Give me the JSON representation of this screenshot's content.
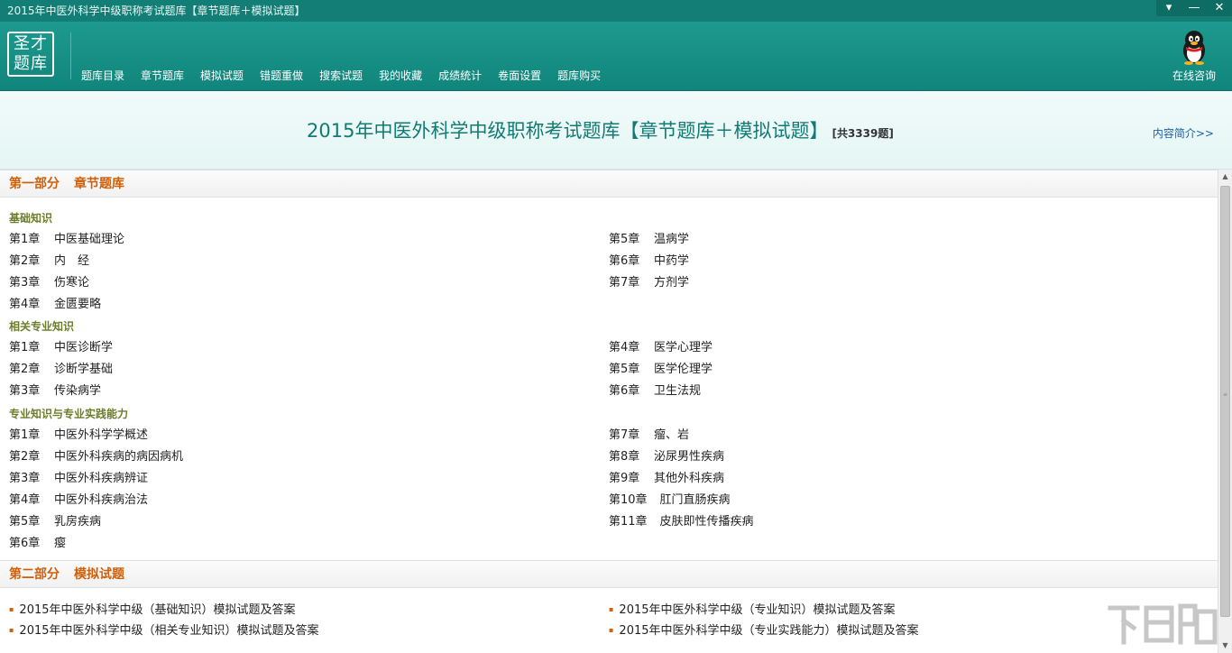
{
  "window": {
    "title": "2015年中医外科学中级职称考试题库【章节题库＋模拟试题】",
    "controls": [
      "▾",
      "—",
      "✕"
    ]
  },
  "logo": {
    "line1": "圣才",
    "line2": "题库"
  },
  "nav": [
    "题库目录",
    "章节题库",
    "模拟试题",
    "错题重做",
    "搜索试题",
    "我的收藏",
    "成绩统计",
    "卷面设置",
    "题库购买"
  ],
  "consult": {
    "label": "在线咨询",
    "icon": "qq-penguin-icon"
  },
  "header": {
    "title": "2015年中医外科学中级职称考试题库【章节题库＋模拟试题】",
    "count": "[共3339题]",
    "intro_link": "内容简介>>"
  },
  "part1": {
    "label1": "第一部分",
    "label2": "章节题库",
    "groups": [
      {
        "title": "基础知识",
        "left": [
          {
            "num": "第1章",
            "name": "中医基础理论"
          },
          {
            "num": "第2章",
            "name": "内　经"
          },
          {
            "num": "第3章",
            "name": "伤寒论"
          },
          {
            "num": "第4章",
            "name": "金匮要略"
          }
        ],
        "right": [
          {
            "num": "第5章",
            "name": "温病学"
          },
          {
            "num": "第6章",
            "name": "中药学"
          },
          {
            "num": "第7章",
            "name": "方剂学"
          }
        ]
      },
      {
        "title": "相关专业知识",
        "left": [
          {
            "num": "第1章",
            "name": "中医诊断学"
          },
          {
            "num": "第2章",
            "name": "诊断学基础"
          },
          {
            "num": "第3章",
            "name": "传染病学"
          }
        ],
        "right": [
          {
            "num": "第4章",
            "name": "医学心理学"
          },
          {
            "num": "第5章",
            "name": "医学伦理学"
          },
          {
            "num": "第6章",
            "name": "卫生法规"
          }
        ]
      },
      {
        "title": "专业知识与专业实践能力",
        "left": [
          {
            "num": "第1章",
            "name": "中医外科学学概述"
          },
          {
            "num": "第2章",
            "name": "中医外科疾病的病因病机"
          },
          {
            "num": "第3章",
            "name": "中医外科疾病辨证"
          },
          {
            "num": "第4章",
            "name": "中医外科疾病治法"
          },
          {
            "num": "第5章",
            "name": "乳房疾病"
          },
          {
            "num": "第6章",
            "name": "瘿"
          }
        ],
        "right": [
          {
            "num": "第7章",
            "name": "瘤、岩"
          },
          {
            "num": "第8章",
            "name": "泌尿男性疾病"
          },
          {
            "num": "第9章",
            "name": "其他外科疾病"
          },
          {
            "num": "第10章",
            "name": "肛门直肠疾病"
          },
          {
            "num": "第11章",
            "name": "皮肤即性传播疾病"
          }
        ]
      }
    ]
  },
  "part2": {
    "label1": "第二部分",
    "label2": "模拟试题",
    "left": [
      "2015年中医外科学中级（基础知识）模拟试题及答案",
      "2015年中医外科学中级（相关专业知识）模拟试题及答案"
    ],
    "right": [
      "2015年中医外科学中级（专业知识）模拟试题及答案",
      "2015年中医外科学中级（专业实践能力）模拟试题及答案"
    ]
  },
  "watermark": "下载吧",
  "colors": {
    "titlebar": "#137e75",
    "toolbar": "#1a9287",
    "accent": "#d05f09",
    "group_title": "#6b7d2a",
    "heading": "#127a74",
    "link": "#1d5fa8"
  }
}
